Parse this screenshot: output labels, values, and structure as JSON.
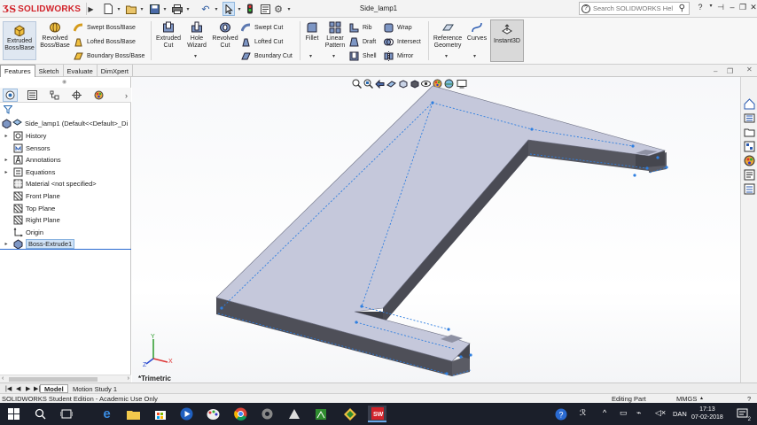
{
  "app": {
    "logo_text": "SOLIDWORKS",
    "document_title": "Side_lamp1",
    "search_placeholder": "Search SOLIDWORKS Help"
  },
  "ribbon": {
    "extruded_boss": "Extruded Boss/Base",
    "revolved_boss": "Revolved Boss/Base",
    "swept_boss": "Swept Boss/Base",
    "lofted_boss": "Lofted Boss/Base",
    "boundary_boss": "Boundary Boss/Base",
    "extruded_cut": "Extruded Cut",
    "hole_wizard": "Hole Wizard",
    "revolved_cut": "Revolved Cut",
    "swept_cut": "Swept Cut",
    "lofted_cut": "Lofted Cut",
    "boundary_cut": "Boundary Cut",
    "fillet": "Fillet",
    "linear_pattern": "Linear Pattern",
    "rib": "Rib",
    "draft": "Draft",
    "shell": "Shell",
    "wrap": "Wrap",
    "intersect": "Intersect",
    "mirror": "Mirror",
    "reference_geometry": "Reference Geometry",
    "curves": "Curves",
    "instant3d": "Instant3D"
  },
  "tabs": [
    "Features",
    "Sketch",
    "Evaluate",
    "DimXpert"
  ],
  "tree": {
    "root": "Side_lamp1  (Default<<Default>_Di",
    "items": [
      {
        "label": "History",
        "expandable": true
      },
      {
        "label": "Sensors",
        "expandable": false
      },
      {
        "label": "Annotations",
        "expandable": true
      },
      {
        "label": "Equations",
        "expandable": true
      },
      {
        "label": "Material <not specified>",
        "expandable": false
      },
      {
        "label": "Front Plane",
        "expandable": false
      },
      {
        "label": "Top Plane",
        "expandable": false
      },
      {
        "label": "Right Plane",
        "expandable": false
      },
      {
        "label": "Origin",
        "expandable": false
      },
      {
        "label": "Boss-Extrude1",
        "expandable": true
      }
    ]
  },
  "viewport": {
    "view_label": "*Trimetric",
    "triad": {
      "x": "X",
      "y": "Y",
      "z": "Z"
    }
  },
  "bottom_tabs": [
    "Model",
    "Motion Study 1"
  ],
  "status": {
    "left": "SOLIDWORKS Student Edition - Academic Use Only",
    "mode": "Editing Part",
    "units": "MMGS"
  },
  "taskbar": {
    "language": "DAN",
    "time": "17:13",
    "date": "07-02-2018",
    "notifications": "2"
  },
  "colors": {
    "brand": "#d2232a",
    "taskbar": "#1b1f2a",
    "part_top": "#c5c8db",
    "part_side": "#55565f"
  }
}
